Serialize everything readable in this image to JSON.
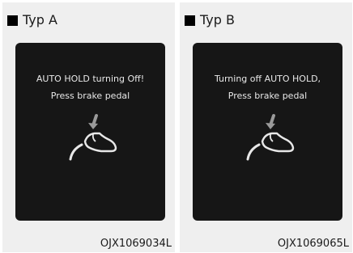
{
  "panels": [
    {
      "title": "Typ A",
      "message_line1": "AUTO HOLD turning Off!",
      "message_line2": "Press brake pedal",
      "image_code": "OJX1069034L"
    },
    {
      "title": "Typ B",
      "message_line1": "Turning off AUTO HOLD,",
      "message_line2": "Press brake pedal",
      "image_code": "OJX1069065L"
    }
  ],
  "icons": {
    "bullet": "black-square-icon",
    "pedal": "brake-pedal-foot-icon"
  },
  "colors": {
    "panel_background": "#efefef",
    "display_background": "#161616",
    "display_text": "#e8e8e8"
  }
}
